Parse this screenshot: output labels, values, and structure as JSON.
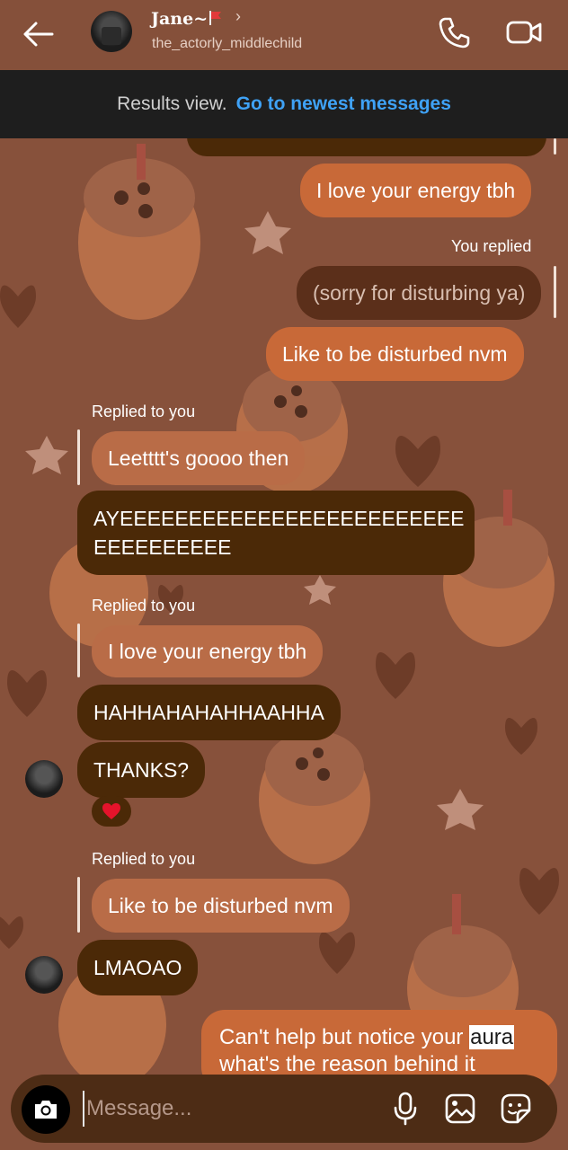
{
  "header": {
    "name": "Jane~",
    "username": "the_actorly_middlechild",
    "chevron": "›"
  },
  "results_bar": {
    "text": "Results view.",
    "link": "Go to newest messages"
  },
  "messages": {
    "out1": "I love your energy tbh",
    "you_replied": "You replied",
    "reply_quote_out": "(sorry for disturbing ya)",
    "out2": "Like to be disturbed nvm",
    "replied_to_you_1": "Replied to you",
    "quote_1": "Leetttt's goooo then",
    "in1_line1": "AYEEEEEEEEEEEEEEEEEEEEEEEEE",
    "in1_line2": "EEEEEEEEEE",
    "replied_to_you_2": "Replied to you",
    "quote_2": "I love your energy tbh",
    "in2": "HAHHAHAHAHHAAHHA",
    "in3": "THANKS?",
    "reaction": "❤",
    "replied_to_you_3": "Replied to you",
    "quote_3": "Like to be disturbed nvm",
    "in4": "LMAOAO",
    "last_out_line1_pre": "Can't help but notice your ",
    "last_out_highlight": "aura",
    "last_out_line2": "what's the reason behind it"
  },
  "composer": {
    "placeholder": "Message..."
  },
  "icons": [
    "back-arrow-icon",
    "flag-icon",
    "phone-icon",
    "video-camera-icon",
    "camera-icon",
    "microphone-icon",
    "gallery-icon",
    "sticker-icon",
    "heart-icon"
  ],
  "colors": {
    "background": "#87513b",
    "outgoing_bubble": "#c86938",
    "incoming_bubble": "#4b2907",
    "quote_bubble": "#b96c47",
    "link": "#3fa2f6"
  }
}
